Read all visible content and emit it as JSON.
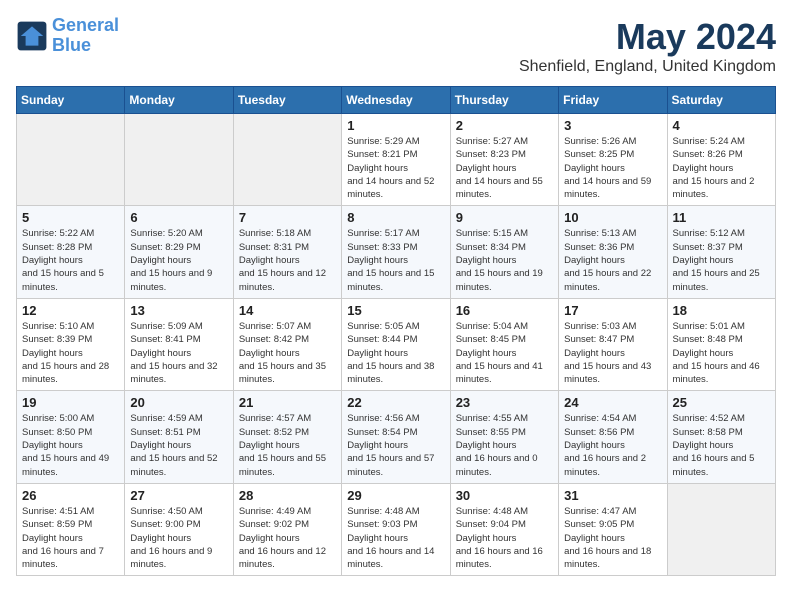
{
  "header": {
    "logo_line1": "General",
    "logo_line2": "Blue",
    "month": "May 2024",
    "location": "Shenfield, England, United Kingdom"
  },
  "days_of_week": [
    "Sunday",
    "Monday",
    "Tuesday",
    "Wednesday",
    "Thursday",
    "Friday",
    "Saturday"
  ],
  "weeks": [
    [
      {
        "day": "",
        "empty": true
      },
      {
        "day": "",
        "empty": true
      },
      {
        "day": "",
        "empty": true
      },
      {
        "day": "1",
        "sunrise": "5:29 AM",
        "sunset": "8:21 PM",
        "daylight": "14 hours and 52 minutes."
      },
      {
        "day": "2",
        "sunrise": "5:27 AM",
        "sunset": "8:23 PM",
        "daylight": "14 hours and 55 minutes."
      },
      {
        "day": "3",
        "sunrise": "5:26 AM",
        "sunset": "8:25 PM",
        "daylight": "14 hours and 59 minutes."
      },
      {
        "day": "4",
        "sunrise": "5:24 AM",
        "sunset": "8:26 PM",
        "daylight": "15 hours and 2 minutes."
      }
    ],
    [
      {
        "day": "5",
        "sunrise": "5:22 AM",
        "sunset": "8:28 PM",
        "daylight": "15 hours and 5 minutes."
      },
      {
        "day": "6",
        "sunrise": "5:20 AM",
        "sunset": "8:29 PM",
        "daylight": "15 hours and 9 minutes."
      },
      {
        "day": "7",
        "sunrise": "5:18 AM",
        "sunset": "8:31 PM",
        "daylight": "15 hours and 12 minutes."
      },
      {
        "day": "8",
        "sunrise": "5:17 AM",
        "sunset": "8:33 PM",
        "daylight": "15 hours and 15 minutes."
      },
      {
        "day": "9",
        "sunrise": "5:15 AM",
        "sunset": "8:34 PM",
        "daylight": "15 hours and 19 minutes."
      },
      {
        "day": "10",
        "sunrise": "5:13 AM",
        "sunset": "8:36 PM",
        "daylight": "15 hours and 22 minutes."
      },
      {
        "day": "11",
        "sunrise": "5:12 AM",
        "sunset": "8:37 PM",
        "daylight": "15 hours and 25 minutes."
      }
    ],
    [
      {
        "day": "12",
        "sunrise": "5:10 AM",
        "sunset": "8:39 PM",
        "daylight": "15 hours and 28 minutes."
      },
      {
        "day": "13",
        "sunrise": "5:09 AM",
        "sunset": "8:41 PM",
        "daylight": "15 hours and 32 minutes."
      },
      {
        "day": "14",
        "sunrise": "5:07 AM",
        "sunset": "8:42 PM",
        "daylight": "15 hours and 35 minutes."
      },
      {
        "day": "15",
        "sunrise": "5:05 AM",
        "sunset": "8:44 PM",
        "daylight": "15 hours and 38 minutes."
      },
      {
        "day": "16",
        "sunrise": "5:04 AM",
        "sunset": "8:45 PM",
        "daylight": "15 hours and 41 minutes."
      },
      {
        "day": "17",
        "sunrise": "5:03 AM",
        "sunset": "8:47 PM",
        "daylight": "15 hours and 43 minutes."
      },
      {
        "day": "18",
        "sunrise": "5:01 AM",
        "sunset": "8:48 PM",
        "daylight": "15 hours and 46 minutes."
      }
    ],
    [
      {
        "day": "19",
        "sunrise": "5:00 AM",
        "sunset": "8:50 PM",
        "daylight": "15 hours and 49 minutes."
      },
      {
        "day": "20",
        "sunrise": "4:59 AM",
        "sunset": "8:51 PM",
        "daylight": "15 hours and 52 minutes."
      },
      {
        "day": "21",
        "sunrise": "4:57 AM",
        "sunset": "8:52 PM",
        "daylight": "15 hours and 55 minutes."
      },
      {
        "day": "22",
        "sunrise": "4:56 AM",
        "sunset": "8:54 PM",
        "daylight": "15 hours and 57 minutes."
      },
      {
        "day": "23",
        "sunrise": "4:55 AM",
        "sunset": "8:55 PM",
        "daylight": "16 hours and 0 minutes."
      },
      {
        "day": "24",
        "sunrise": "4:54 AM",
        "sunset": "8:56 PM",
        "daylight": "16 hours and 2 minutes."
      },
      {
        "day": "25",
        "sunrise": "4:52 AM",
        "sunset": "8:58 PM",
        "daylight": "16 hours and 5 minutes."
      }
    ],
    [
      {
        "day": "26",
        "sunrise": "4:51 AM",
        "sunset": "8:59 PM",
        "daylight": "16 hours and 7 minutes."
      },
      {
        "day": "27",
        "sunrise": "4:50 AM",
        "sunset": "9:00 PM",
        "daylight": "16 hours and 9 minutes."
      },
      {
        "day": "28",
        "sunrise": "4:49 AM",
        "sunset": "9:02 PM",
        "daylight": "16 hours and 12 minutes."
      },
      {
        "day": "29",
        "sunrise": "4:48 AM",
        "sunset": "9:03 PM",
        "daylight": "16 hours and 14 minutes."
      },
      {
        "day": "30",
        "sunrise": "4:48 AM",
        "sunset": "9:04 PM",
        "daylight": "16 hours and 16 minutes."
      },
      {
        "day": "31",
        "sunrise": "4:47 AM",
        "sunset": "9:05 PM",
        "daylight": "16 hours and 18 minutes."
      },
      {
        "day": "",
        "empty": true
      }
    ]
  ]
}
